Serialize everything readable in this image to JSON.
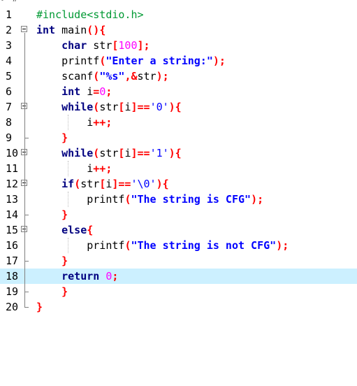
{
  "editor": {
    "top_fragment": "> #",
    "lines": [
      {
        "n": "1",
        "tokens": [
          {
            "t": "#include<stdio.h>",
            "c": "pp"
          }
        ]
      },
      {
        "n": "2",
        "tokens": [
          {
            "t": "int",
            "c": "kw"
          },
          {
            "t": " main",
            "c": "plain"
          },
          {
            "t": "()",
            "c": "br"
          },
          {
            "t": "{",
            "c": "br"
          }
        ]
      },
      {
        "n": "3",
        "tokens": [
          {
            "t": "    ",
            "c": "plain"
          },
          {
            "t": "char",
            "c": "kw"
          },
          {
            "t": " str",
            "c": "plain"
          },
          {
            "t": "[",
            "c": "br"
          },
          {
            "t": "100",
            "c": "num"
          },
          {
            "t": "];",
            "c": "br"
          }
        ]
      },
      {
        "n": "4",
        "tokens": [
          {
            "t": "    printf",
            "c": "plain"
          },
          {
            "t": "(",
            "c": "br"
          },
          {
            "t": "\"Enter a string:\"",
            "c": "str"
          },
          {
            "t": ");",
            "c": "br"
          }
        ]
      },
      {
        "n": "5",
        "tokens": [
          {
            "t": "    scanf",
            "c": "plain"
          },
          {
            "t": "(",
            "c": "br"
          },
          {
            "t": "\"%s\"",
            "c": "str"
          },
          {
            "t": ",&",
            "c": "br"
          },
          {
            "t": "str",
            "c": "plain"
          },
          {
            "t": ");",
            "c": "br"
          }
        ]
      },
      {
        "n": "6",
        "tokens": [
          {
            "t": "    ",
            "c": "plain"
          },
          {
            "t": "int",
            "c": "kw"
          },
          {
            "t": " i",
            "c": "plain"
          },
          {
            "t": "=",
            "c": "br"
          },
          {
            "t": "0",
            "c": "num"
          },
          {
            "t": ";",
            "c": "br"
          }
        ]
      },
      {
        "n": "7",
        "tokens": [
          {
            "t": "    ",
            "c": "plain"
          },
          {
            "t": "while",
            "c": "kw"
          },
          {
            "t": "(",
            "c": "br"
          },
          {
            "t": "str",
            "c": "plain"
          },
          {
            "t": "[",
            "c": "br"
          },
          {
            "t": "i",
            "c": "plain"
          },
          {
            "t": "]==",
            "c": "br"
          },
          {
            "t": "'0'",
            "c": "ch"
          },
          {
            "t": "){",
            "c": "br"
          }
        ]
      },
      {
        "n": "8",
        "tokens": [
          {
            "t": "        i",
            "c": "plain"
          },
          {
            "t": "++;",
            "c": "br"
          }
        ]
      },
      {
        "n": "9",
        "tokens": [
          {
            "t": "    ",
            "c": "plain"
          },
          {
            "t": "}",
            "c": "br"
          }
        ]
      },
      {
        "n": "10",
        "tokens": [
          {
            "t": "    ",
            "c": "plain"
          },
          {
            "t": "while",
            "c": "kw"
          },
          {
            "t": "(",
            "c": "br"
          },
          {
            "t": "str",
            "c": "plain"
          },
          {
            "t": "[",
            "c": "br"
          },
          {
            "t": "i",
            "c": "plain"
          },
          {
            "t": "]==",
            "c": "br"
          },
          {
            "t": "'1'",
            "c": "ch"
          },
          {
            "t": "){",
            "c": "br"
          }
        ]
      },
      {
        "n": "11",
        "tokens": [
          {
            "t": "        i",
            "c": "plain"
          },
          {
            "t": "++;",
            "c": "br"
          }
        ]
      },
      {
        "n": "12",
        "tokens": [
          {
            "t": "    ",
            "c": "plain"
          },
          {
            "t": "if",
            "c": "kw"
          },
          {
            "t": "(",
            "c": "br"
          },
          {
            "t": "str",
            "c": "plain"
          },
          {
            "t": "[",
            "c": "br"
          },
          {
            "t": "i",
            "c": "plain"
          },
          {
            "t": "]==",
            "c": "br"
          },
          {
            "t": "'\\0'",
            "c": "ch"
          },
          {
            "t": "){",
            "c": "br"
          }
        ]
      },
      {
        "n": "13",
        "tokens": [
          {
            "t": "        printf",
            "c": "plain"
          },
          {
            "t": "(",
            "c": "br"
          },
          {
            "t": "\"The string is CFG\"",
            "c": "str"
          },
          {
            "t": ");",
            "c": "br"
          }
        ]
      },
      {
        "n": "14",
        "tokens": [
          {
            "t": "    ",
            "c": "plain"
          },
          {
            "t": "}",
            "c": "br"
          }
        ]
      },
      {
        "n": "15",
        "tokens": [
          {
            "t": "    ",
            "c": "plain"
          },
          {
            "t": "else",
            "c": "kw"
          },
          {
            "t": "{",
            "c": "br"
          }
        ]
      },
      {
        "n": "16",
        "tokens": [
          {
            "t": "        printf",
            "c": "plain"
          },
          {
            "t": "(",
            "c": "br"
          },
          {
            "t": "\"The string is not CFG\"",
            "c": "str"
          },
          {
            "t": ");",
            "c": "br"
          }
        ]
      },
      {
        "n": "17",
        "tokens": [
          {
            "t": "    ",
            "c": "plain"
          },
          {
            "t": "}",
            "c": "br"
          }
        ]
      },
      {
        "n": "18",
        "active": true,
        "tokens": [
          {
            "t": "    ",
            "c": "plain"
          },
          {
            "t": "return",
            "c": "kw"
          },
          {
            "t": " ",
            "c": "plain"
          },
          {
            "t": "0",
            "c": "num"
          },
          {
            "t": ";",
            "c": "br"
          }
        ]
      },
      {
        "n": "19",
        "tokens": [
          {
            "t": "    ",
            "c": "plain"
          },
          {
            "t": "}",
            "c": "br"
          }
        ]
      },
      {
        "n": "20",
        "tokens": [
          {
            "t": "}",
            "c": "br"
          }
        ]
      }
    ],
    "fold_markers": [
      "2",
      "7",
      "10",
      "12",
      "15"
    ]
  },
  "colors": {
    "active_line": "#ccf0ff",
    "keyword": "#000080",
    "string": "#0000ff",
    "number": "#ff00ff",
    "operator": "#ff0000",
    "preprocessor": "#009933"
  }
}
